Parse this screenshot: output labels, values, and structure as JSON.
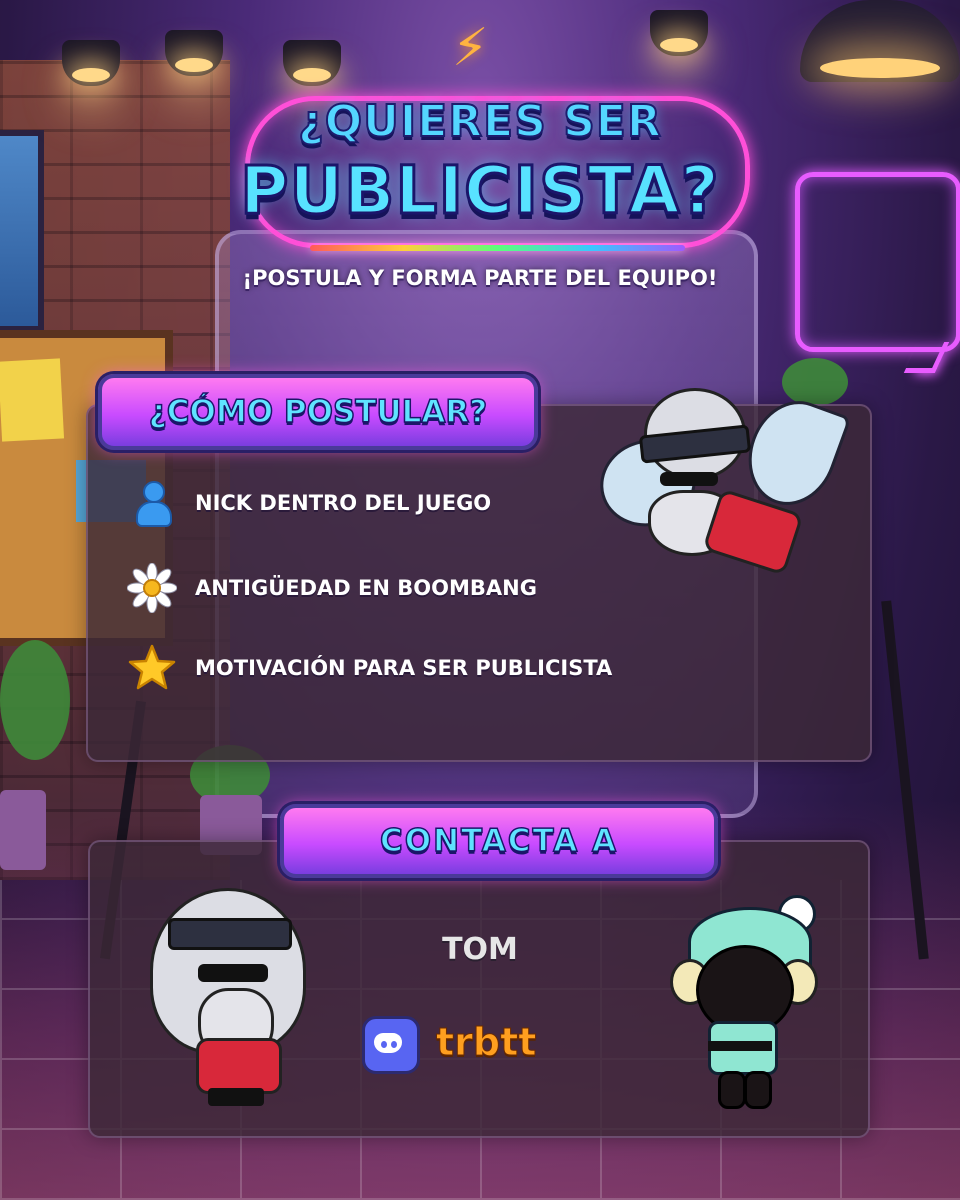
{
  "header": {
    "title_line1": "¿QUIERES SER",
    "title_line2": "PUBLICISTA?",
    "subtitle": "¡POSTULA Y FORMA PARTE DEL EQUIPO!"
  },
  "how_to_apply": {
    "heading": "¿CÓMO POSTULAR?",
    "requirements": [
      {
        "icon": "person-icon",
        "label": "NICK DENTRO DEL JUEGO"
      },
      {
        "icon": "daisy-icon",
        "label": "ANTIGÜEDAD EN BOOMBANG"
      },
      {
        "icon": "star-icon",
        "label": "MOTIVACIÓN PARA SER PUBLICISTA"
      }
    ]
  },
  "contact": {
    "heading": "CONTACTA  A",
    "name": "TOM",
    "discord_handle": "trbtt",
    "discord_icon": "discord-icon"
  },
  "colors": {
    "title_blue": "#58e2ff",
    "neon_pink": "#ff4fd8",
    "discord_blurple": "#5865f2",
    "handle_orange": "#ff9f1f"
  }
}
